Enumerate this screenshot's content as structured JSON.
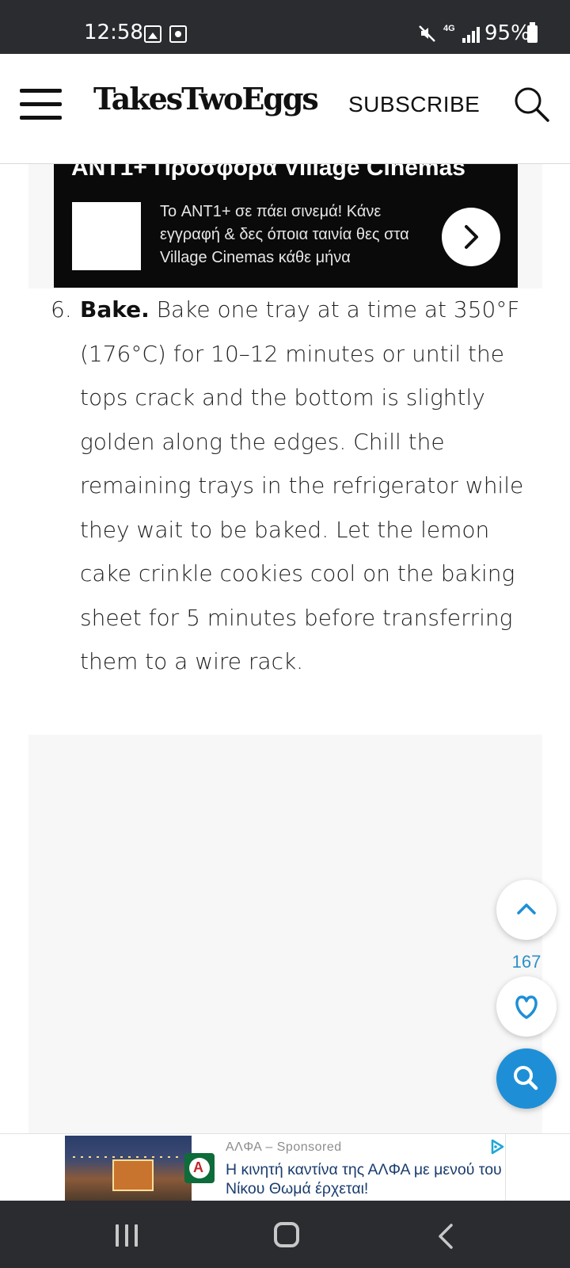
{
  "status_bar": {
    "time": "12:58",
    "network": "4G",
    "battery": "95%"
  },
  "header": {
    "logo": "TakesTwoEggs",
    "subscribe_label": "SUBSCRIBE"
  },
  "top_ad": {
    "title": "ANT1+ Προσφορά Village Cinemas",
    "body": "Το ANT1+ σε πάει σινεμά! Κάνε εγγραφή & δες όποια ταινία θες στα Village Cinemas κάθε μήνα"
  },
  "recipe_step": {
    "number": "6.",
    "heading": "Bake.",
    "text": " Bake one tray at a time at 350°F (176°C) for 10–12 minutes or until the tops crack and the bottom is slightly golden along the edges. Chill the remaining trays in the refrigerator while they wait to be baked. Let the lemon cake crinkle cookies cool on the baking sheet for 5 minutes before transferring them to a wire rack."
  },
  "floating": {
    "heart_count": "167"
  },
  "bottom_ad": {
    "sponsor": "ΑΛΦΑ – Sponsored",
    "title": "Η κινητή καντίνα της ΑΛΦΑ με μενού του Νίκου Θωμά έρχεται!",
    "logo_letter": "A"
  },
  "colors": {
    "accent_blue": "#1e8fd6",
    "status_bar_bg": "#2b2c30",
    "ad_bg": "#0a0a0a",
    "count_blue": "#2f8fc7"
  },
  "icons": {
    "menu": "hamburger-icon",
    "search": "search-icon",
    "arrow": "chevron-right-icon",
    "up": "chevron-up-icon",
    "heart": "heart-icon",
    "back": "chevron-left-icon"
  }
}
